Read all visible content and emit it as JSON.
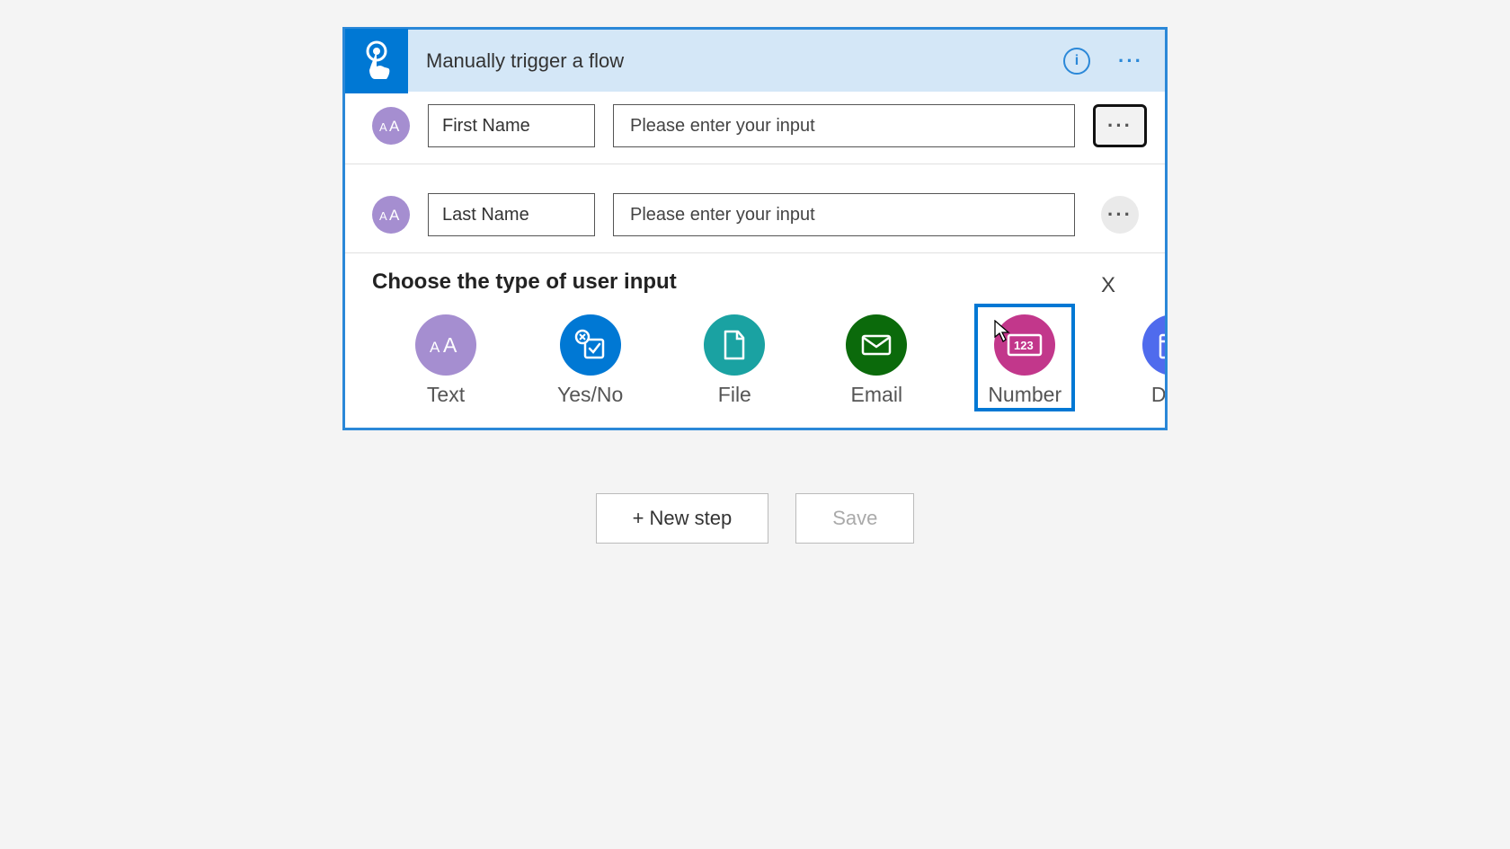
{
  "trigger": {
    "title": "Manually trigger a flow",
    "inputs": [
      {
        "label": "First Name",
        "placeholder": "Please enter your input",
        "value": ""
      },
      {
        "label": "Last Name",
        "placeholder": "Please enter your input",
        "value": ""
      }
    ],
    "choose": {
      "title": "Choose the type of user input",
      "close": "X",
      "options": [
        {
          "id": "text",
          "label": "Text",
          "color": "#a58ed0"
        },
        {
          "id": "yesno",
          "label": "Yes/No",
          "color": "#0078d4"
        },
        {
          "id": "file",
          "label": "File",
          "color": "#1aa2a2"
        },
        {
          "id": "email",
          "label": "Email",
          "color": "#0b6a0b"
        },
        {
          "id": "number",
          "label": "Number",
          "color": "#c2378b",
          "selected": true
        },
        {
          "id": "date",
          "label": "Date",
          "color": "#4f6bed"
        }
      ]
    }
  },
  "actions": {
    "new_step": "+ New step",
    "save": "Save"
  }
}
